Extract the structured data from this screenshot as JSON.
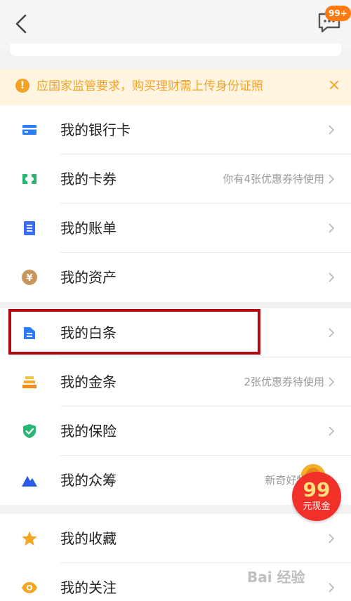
{
  "header": {
    "back_icon": "chevron-left-icon",
    "message_icon": "chat-bubble-icon",
    "message_badge": "99+"
  },
  "notice": {
    "text": "应国家监管要求，购买理财需上传身份证照",
    "close": "×"
  },
  "groups": [
    {
      "items": [
        {
          "label": "我的银行卡",
          "hint": "",
          "icon": "bank-card-icon",
          "color": "#2c7ef8"
        },
        {
          "label": "我的卡券",
          "hint": "你有4张优惠券待使用",
          "icon": "coupon-icon",
          "color": "#2bb673"
        },
        {
          "label": "我的账单",
          "hint": "",
          "icon": "bill-icon",
          "color": "#3b6df2"
        },
        {
          "label": "我的资产",
          "hint": "",
          "icon": "yen-coin-icon",
          "color": "#c9955a"
        }
      ]
    },
    {
      "items": [
        {
          "label": "我的白条",
          "hint": "",
          "icon": "iou-icon",
          "color": "#2c7ef8"
        },
        {
          "label": "我的金条",
          "hint": "2张优惠券待使用",
          "icon": "gold-bar-icon",
          "color": "#f5a623"
        },
        {
          "label": "我的保险",
          "hint": "",
          "icon": "shield-check-icon",
          "color": "#2bb673"
        },
        {
          "label": "我的众筹",
          "hint": "新奇好物1元",
          "icon": "mountain-icon",
          "color": "#2a5ae8"
        }
      ]
    },
    {
      "items": [
        {
          "label": "我的收藏",
          "hint": "",
          "icon": "star-icon",
          "color": "#f5a623"
        },
        {
          "label": "我的关注",
          "hint": "",
          "icon": "eye-icon",
          "color": "#f5a623"
        }
      ]
    }
  ],
  "promo": {
    "amount": "99",
    "text": "元现金"
  },
  "watermark": "Bai 经验"
}
